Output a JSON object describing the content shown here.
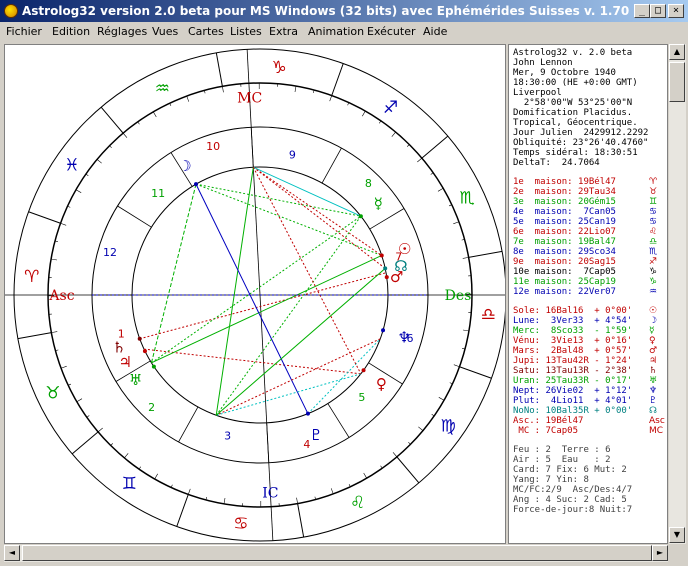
{
  "window": {
    "title": "Astrolog32 version 2.0 beta pour MS Windows (32 bits) avec Ephémérides Suisses v. 1.70",
    "minimize_label": "_",
    "maximize_label": "□",
    "close_label": "×"
  },
  "menu": [
    "Fichier",
    "Edition",
    "Réglages",
    "Vues",
    "Cartes",
    "Listes",
    "Extra",
    "Animation",
    "Exécuter",
    "Aide"
  ],
  "info": {
    "header": [
      "Astrolog32 v. 2.0 beta",
      "John Lennon",
      "Mer, 9 Octobre 1940",
      "18:30:00 (HE +0:00 GMT)",
      "Liverpool",
      "  2°58'00\"W 53°25'00\"N",
      "Domification Placidus.",
      "Tropical, Géocentrique.",
      "Jour Julien  2429912.2292",
      "Obliquité: 23°26'40.4760\"",
      "Temps sidéral: 18:30:51",
      "DeltaT:  24.7064"
    ],
    "houses": [
      {
        "text": "1e  maison: 19Bél47",
        "sym": "♈",
        "color": "#c00000"
      },
      {
        "text": "2e  maison: 29Tau34",
        "sym": "♉",
        "color": "#c00000"
      },
      {
        "text": "3e  maison: 20Gém15",
        "sym": "♊",
        "color": "#00a000"
      },
      {
        "text": "4e  maison:  7Can05",
        "sym": "♋",
        "color": "#0000b0"
      },
      {
        "text": "5e  maison: 25Can19",
        "sym": "♋",
        "color": "#0000b0"
      },
      {
        "text": "6e  maison: 22Lio07",
        "sym": "♌",
        "color": "#c00000"
      },
      {
        "text": "7e  maison: 19Bal47",
        "sym": "♎",
        "color": "#00a000"
      },
      {
        "text": "8e  maison: 29Sco34",
        "sym": "♏",
        "color": "#0000b0"
      },
      {
        "text": "9e  maison: 20Sag15",
        "sym": "♐",
        "color": "#c00000"
      },
      {
        "text": "10e maison:  7Cap05",
        "sym": "♑",
        "color": "#000000"
      },
      {
        "text": "11e maison: 25Cap19",
        "sym": "♑",
        "color": "#00a000"
      },
      {
        "text": "12e maison: 22Ver07",
        "sym": "♒",
        "color": "#0000b0"
      }
    ],
    "planets": [
      {
        "text": "Sole: 16Bal16  + 0°00'",
        "sym": "☉",
        "color": "#c00000"
      },
      {
        "text": "Lune:  3Ver33  + 4°54'",
        "sym": "☽",
        "color": "#0000b0"
      },
      {
        "text": "Merc:  8Sco33  - 1°59'",
        "sym": "☿",
        "color": "#00a000"
      },
      {
        "text": "Vénu:  3Vie13  + 0°16'",
        "sym": "♀",
        "color": "#c00000"
      },
      {
        "text": "Mars:  2Bal48  + 0°57'",
        "sym": "♂",
        "color": "#c00000"
      },
      {
        "text": "Jupi: 13Tau42R - 1°24'",
        "sym": "♃",
        "color": "#c00000"
      },
      {
        "text": "Satu: 13Tau13R - 2°38'",
        "sym": "♄",
        "color": "#800000"
      },
      {
        "text": "Uran: 25Tau33R - 0°17'",
        "sym": "♅",
        "color": "#00a000"
      },
      {
        "text": "Nept: 26Vie02  + 1°12'",
        "sym": "♆",
        "color": "#0000b0"
      },
      {
        "text": "Plut:  4Lio11  + 4°01'",
        "sym": "♇",
        "color": "#0000b0"
      },
      {
        "text": "NoNo: 10Bal35R + 0°00'",
        "sym": "☊",
        "color": "#008080"
      },
      {
        "text": "Asc.: 19Bél47",
        "sym": "Asc",
        "color": "#c00000"
      },
      {
        "text": " MC : 7Cap05",
        "sym": "MC",
        "color": "#c00000"
      }
    ],
    "stats": [
      "Feu : 2  Terre : 6",
      "Air : 5  Eau   : 2",
      "Card: 7 Fix: 6 Mut: 2",
      "Yang: 7 Yin: 8",
      "MC/FC:2/9  Asc/Des:4/7",
      "Ang : 4 Suc: 2 Cad: 5",
      "Force-de-jour:8 Nuit:7"
    ]
  },
  "wheel": {
    "signs": [
      "♑",
      "♒",
      "♓",
      "♈",
      "♉",
      "♊",
      "♋",
      "♌",
      "♍",
      "♎",
      "♏",
      "♐"
    ],
    "sign_colors": [
      "#c00000",
      "#00a000",
      "#0000b0",
      "#c00000",
      "#00a000",
      "#0000b0",
      "#c00000",
      "#00a000",
      "#0000b0",
      "#c00000",
      "#00a000",
      "#0000b0"
    ],
    "house_numbers": [
      "1",
      "2",
      "3",
      "4",
      "5",
      "6",
      "7",
      "8",
      "9",
      "10",
      "11",
      "12"
    ],
    "angles": {
      "asc": "Asc",
      "des": "Des",
      "mc": "MC",
      "ic": "IC"
    },
    "planet_glyphs": [
      {
        "sym": "☽",
        "color": "#0000b0"
      },
      {
        "sym": "☿",
        "color": "#00a000"
      },
      {
        "sym": "☉",
        "color": "#c00000"
      },
      {
        "sym": "☊",
        "color": "#008080"
      },
      {
        "sym": "♂",
        "color": "#c00000"
      },
      {
        "sym": "♆",
        "color": "#0000b0"
      },
      {
        "sym": "♀",
        "color": "#c00000"
      },
      {
        "sym": "♇",
        "color": "#0000b0"
      },
      {
        "sym": "♄",
        "color": "#800000"
      },
      {
        "sym": "♃",
        "color": "#c00000"
      },
      {
        "sym": "♅",
        "color": "#00a000"
      }
    ]
  }
}
